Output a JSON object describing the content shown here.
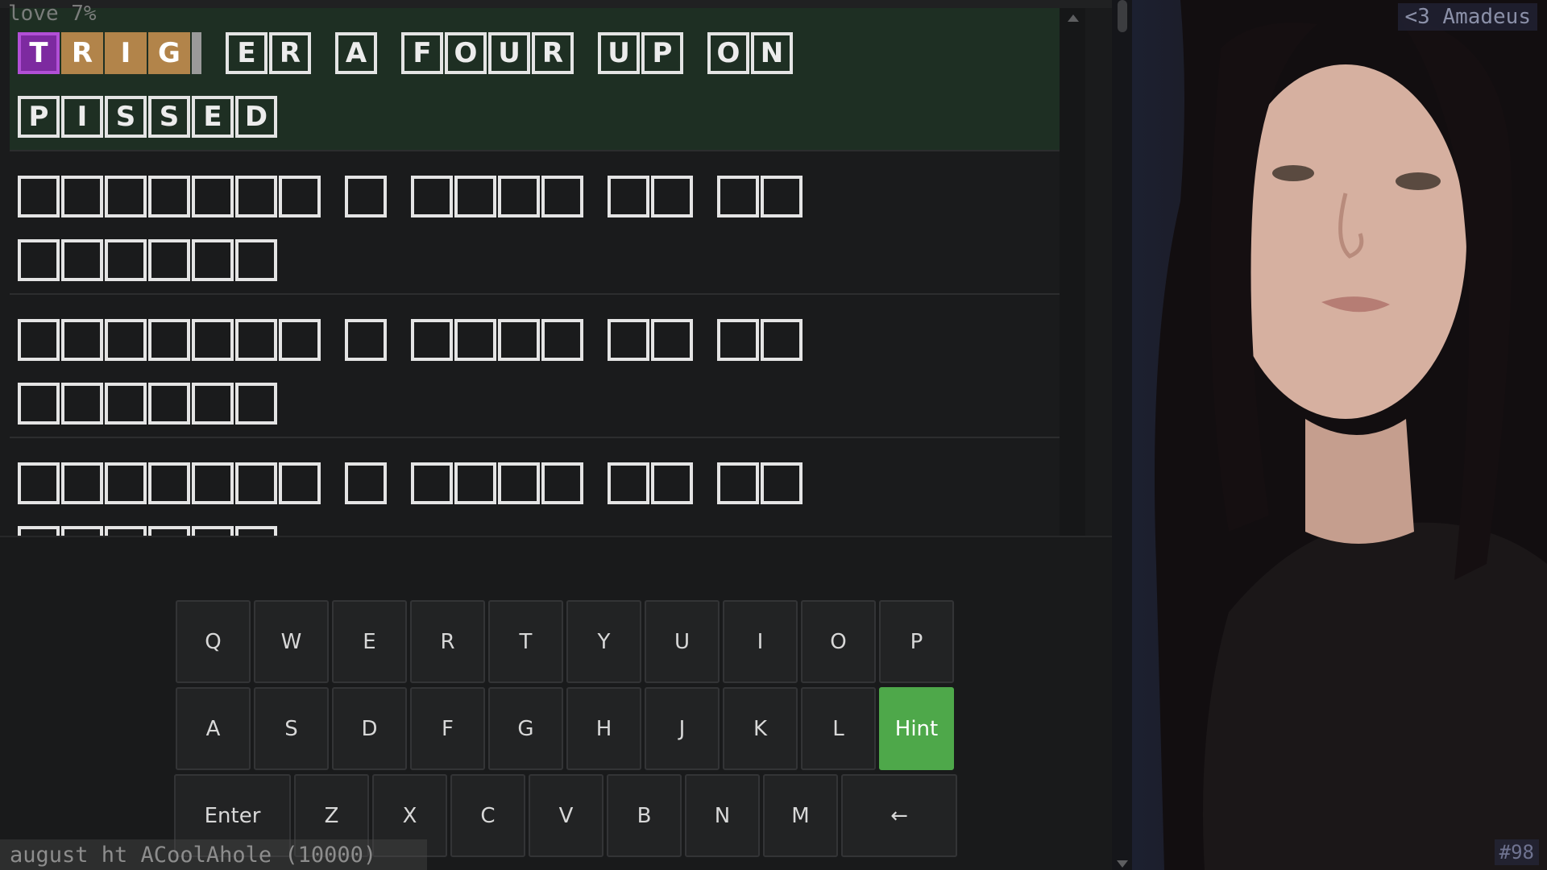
{
  "overlay": {
    "top_left_text": "love 7%",
    "ticker_text": "august ht ACoolAhole (10000)",
    "webcam_label": "<3 Amadeus",
    "webcam_counter": "#98"
  },
  "puzzle": {
    "rows": [
      {
        "state": "solved",
        "line1": [
          {
            "letters": [
              "T",
              "R",
              "I",
              "G"
            ],
            "styles": [
              "purple",
              "orange",
              "orange",
              "orange"
            ],
            "partial_tail": true
          },
          {
            "letters": [
              "E",
              "R"
            ]
          },
          {
            "letters": [
              "A"
            ]
          },
          {
            "letters": [
              "F",
              "O",
              "U",
              "R"
            ]
          },
          {
            "letters": [
              "U",
              "P"
            ]
          },
          {
            "letters": [
              "O",
              "N"
            ]
          }
        ],
        "line2": [
          {
            "letters": [
              "P",
              "I",
              "S",
              "S",
              "E",
              "D"
            ]
          }
        ]
      },
      {
        "state": "empty",
        "line1": [
          {
            "letters": [
              "",
              "",
              "",
              "",
              "",
              "",
              ""
            ]
          },
          {
            "letters": [
              ""
            ]
          },
          {
            "letters": [
              "",
              "",
              "",
              ""
            ]
          },
          {
            "letters": [
              "",
              ""
            ]
          },
          {
            "letters": [
              "",
              ""
            ]
          }
        ],
        "line2": [
          {
            "letters": [
              "",
              "",
              "",
              "",
              "",
              ""
            ]
          }
        ]
      },
      {
        "state": "empty",
        "line1": [
          {
            "letters": [
              "",
              "",
              "",
              "",
              "",
              "",
              ""
            ]
          },
          {
            "letters": [
              ""
            ]
          },
          {
            "letters": [
              "",
              "",
              "",
              ""
            ]
          },
          {
            "letters": [
              "",
              ""
            ]
          },
          {
            "letters": [
              "",
              ""
            ]
          }
        ],
        "line2": [
          {
            "letters": [
              "",
              "",
              "",
              "",
              "",
              ""
            ]
          }
        ]
      },
      {
        "state": "empty",
        "line1": [
          {
            "letters": [
              "",
              "",
              "",
              "",
              "",
              "",
              ""
            ]
          },
          {
            "letters": [
              ""
            ]
          },
          {
            "letters": [
              "",
              "",
              "",
              ""
            ]
          },
          {
            "letters": [
              "",
              ""
            ]
          },
          {
            "letters": [
              "",
              ""
            ]
          }
        ],
        "line2": [
          {
            "letters": [
              "",
              "",
              "",
              "",
              "",
              ""
            ]
          }
        ]
      }
    ]
  },
  "keyboard": {
    "rows": [
      [
        "Q",
        "W",
        "E",
        "R",
        "T",
        "Y",
        "U",
        "I",
        "O",
        "P"
      ],
      [
        "A",
        "S",
        "D",
        "F",
        "G",
        "H",
        "J",
        "K",
        "L",
        "Hint"
      ],
      [
        "Enter",
        "Z",
        "X",
        "C",
        "V",
        "B",
        "N",
        "M",
        "←"
      ]
    ]
  },
  "colors": {
    "purple_tile": "#7d2aa0",
    "orange_tile": "#b2844a",
    "hint_key": "#4ea84a",
    "solved_row_bg": "#1e2f23"
  }
}
